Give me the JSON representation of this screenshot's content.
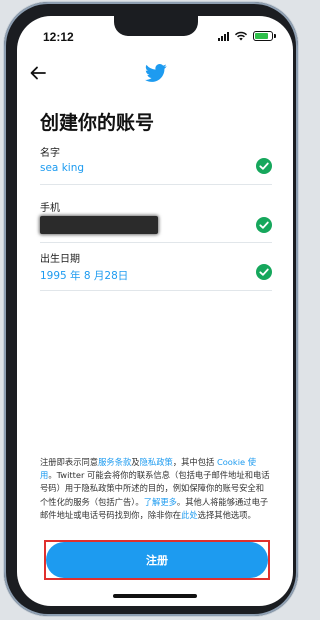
{
  "status_bar": {
    "time": "12:12"
  },
  "title": "创建你的账号",
  "fields": {
    "name": {
      "label": "名字",
      "value": "sea king"
    },
    "phone": {
      "label": "手机"
    },
    "birth": {
      "label": "出生日期",
      "value": "1995 年 8 月28日"
    }
  },
  "legal": {
    "p1": "注册即表示同意",
    "tos": "服务条款",
    "p2": "及",
    "privacy": "隐私政策",
    "p3": "，其中包括 ",
    "cookie": "Cookie 使用",
    "p4": "。Twitter 可能会将你的联系信息（包括电子邮件地址和电话号码）用于隐私政策中所述的目的，例如保障你的账号安全和个性化的服务（包括广告）。",
    "learn_more": "了解更多",
    "p5": "。其他人将能够通过电子邮件地址或电话号码找到你，除非你在",
    "here": "此处",
    "p6": "选择其他选项。"
  },
  "signup_button": "注册",
  "colors": {
    "accent": "#1d9bf0",
    "success": "#16a75c",
    "highlight": "#e0302e"
  },
  "icons": [
    "back-arrow-icon",
    "twitter-bird-icon",
    "checkmark-icon",
    "signal-icon",
    "wifi-icon",
    "battery-icon"
  ]
}
